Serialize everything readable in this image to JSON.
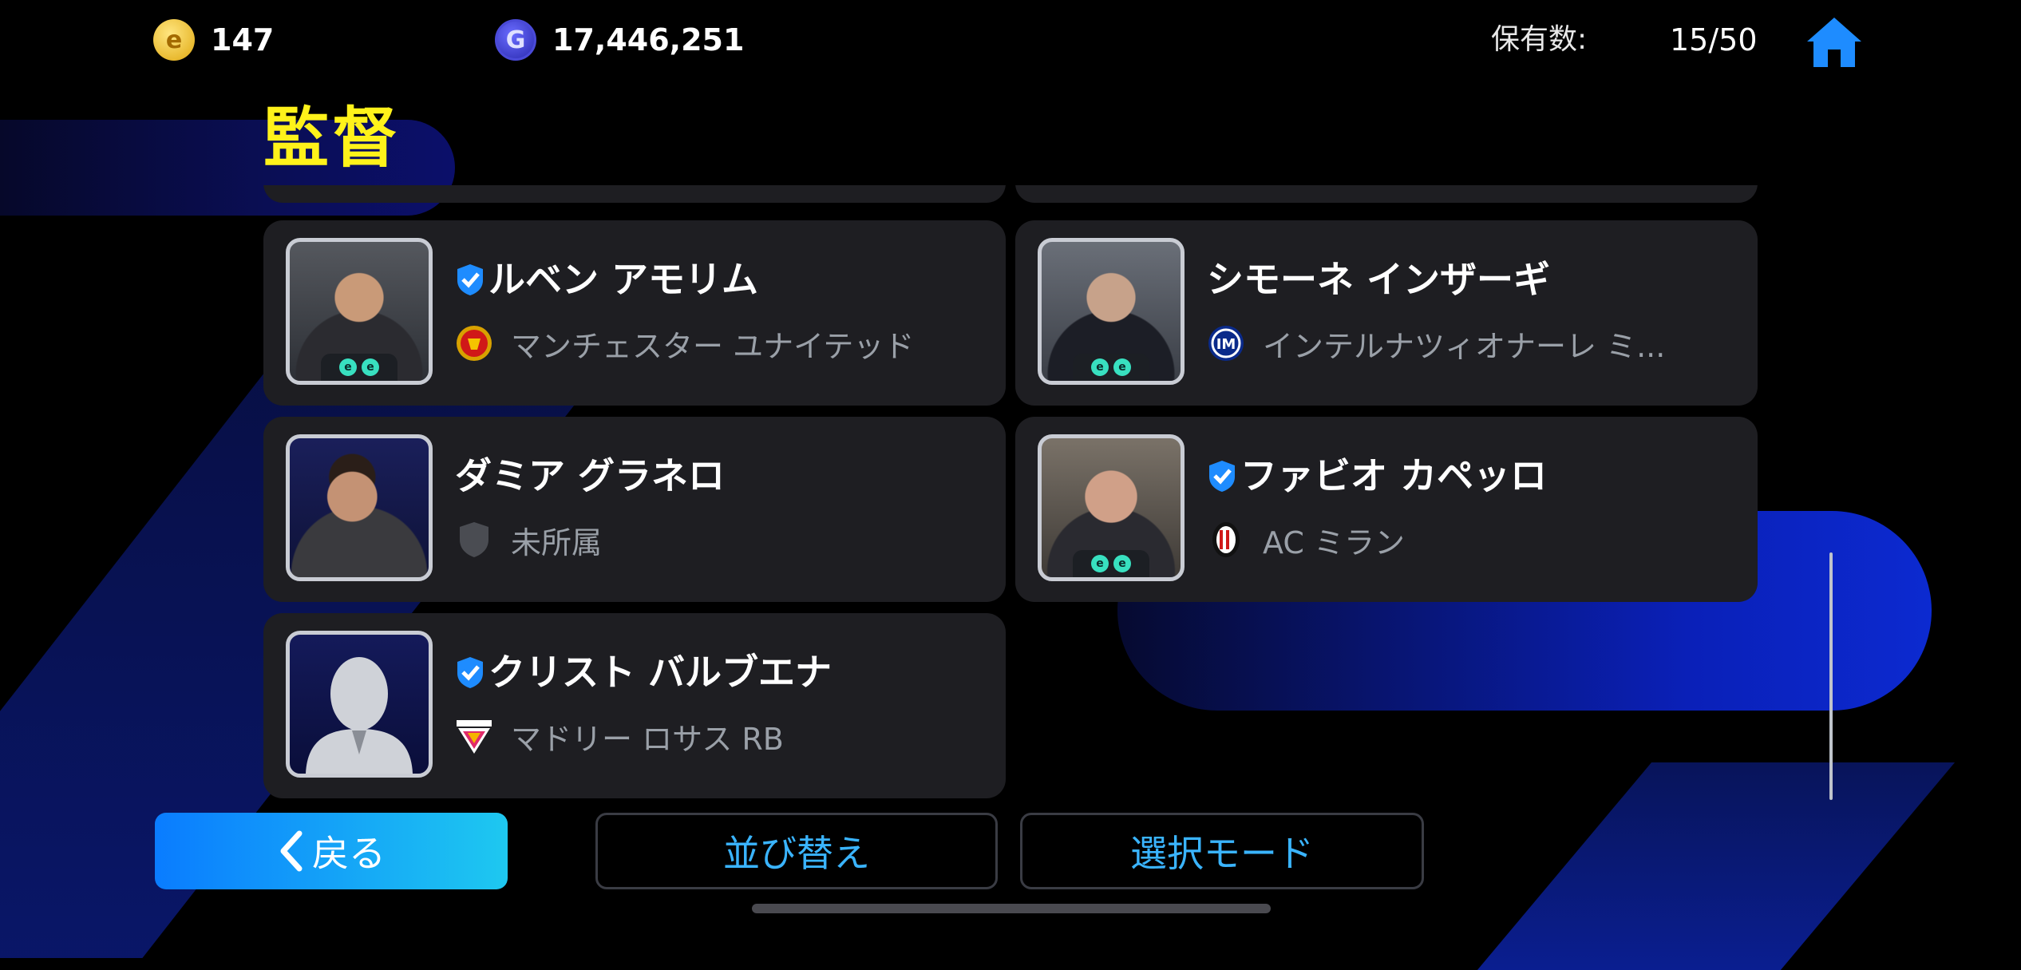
{
  "currency": {
    "coins": "147",
    "gp": "17,446,251"
  },
  "holdings": {
    "label": "保有数:",
    "value": "15/50"
  },
  "page_title": "監督",
  "managers": [
    {
      "name": "ルベン アモリム",
      "verified": true,
      "club": "マンチェスター ユナイテッド",
      "club_icon": "man-utd-crest-icon",
      "has_badges": true
    },
    {
      "name": "シモーネ インザーギ",
      "verified": false,
      "club": "インテルナツィオナーレ ミ...",
      "club_icon": "inter-crest-icon",
      "has_badges": true
    },
    {
      "name": "ダミア グラネロ",
      "verified": false,
      "club": "未所属",
      "club_icon": "shield-icon",
      "has_badges": false
    },
    {
      "name": "ファビオ カペッロ",
      "verified": true,
      "club": "AC ミラン",
      "club_icon": "ac-milan-crest-icon",
      "has_badges": true
    },
    {
      "name": "クリスト バルブエナ",
      "verified": true,
      "club": "マドリー ロサス RB",
      "club_icon": "madrid-rosas-crest-icon",
      "has_badges": false
    }
  ],
  "buttons": {
    "back": "戻る",
    "sort": "並び替え",
    "select_mode": "選択モード"
  },
  "colors": {
    "title": "#fff21a",
    "accent_blue": "#3ab4ff",
    "card_bg": "#1e1e22"
  }
}
